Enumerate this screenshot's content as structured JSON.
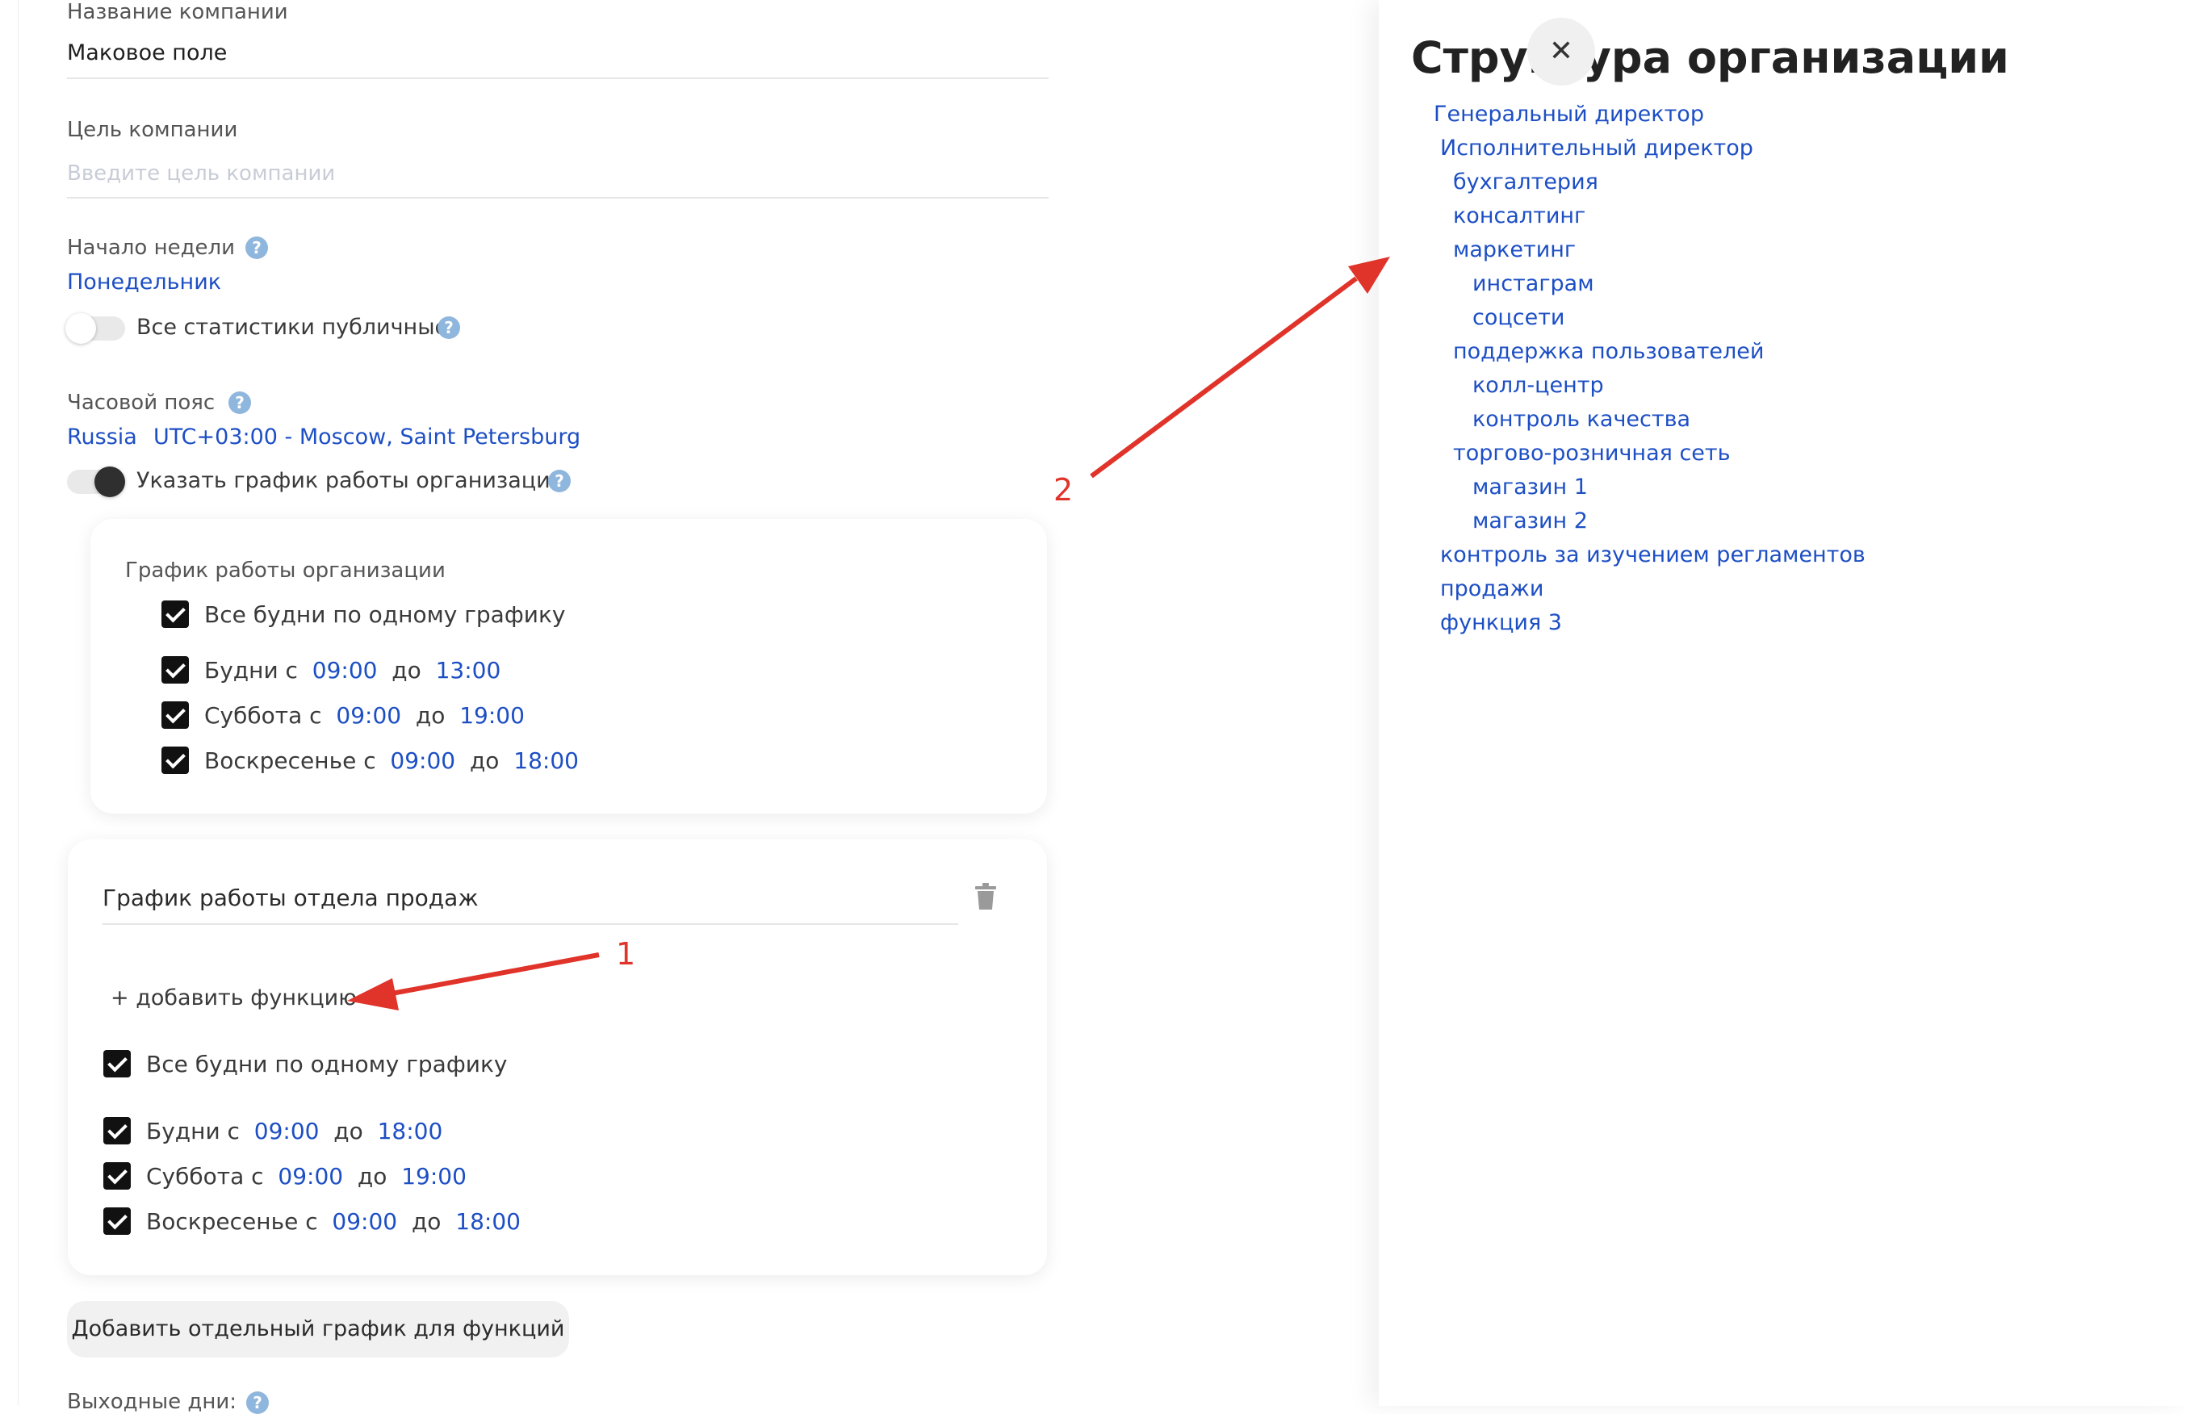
{
  "left": {
    "company_name": {
      "label": "Название компании",
      "value": "Маковое поле"
    },
    "company_goal": {
      "label": "Цель компании",
      "placeholder": "Введите цель компании"
    },
    "week_start": {
      "label": "Начало недели",
      "value": "Понедельник"
    },
    "public_stats": {
      "label": "Все статистики публичные",
      "on": false
    },
    "timezone": {
      "label": "Часовой пояс",
      "country": "Russia",
      "value": "UTC+03:00 - Moscow, Saint Petersburg"
    },
    "schedule_toggle": {
      "label": "Указать график работы организации",
      "on": true
    },
    "org_schedule": {
      "title": "График работы организации",
      "all_weekdays": "Все будни по одному графику",
      "rows": [
        {
          "prefix": "Будни с",
          "from": "09:00",
          "sep": "до",
          "to": "13:00"
        },
        {
          "prefix": "Суббота с",
          "from": "09:00",
          "sep": "до",
          "to": "19:00"
        },
        {
          "prefix": "Воскресенье с",
          "from": "09:00",
          "sep": "до",
          "to": "18:00"
        }
      ]
    },
    "sales_schedule": {
      "title": "График работы отдела продаж",
      "add_function": "+ добавить функцию",
      "all_weekdays": "Все будни по одному графику",
      "rows": [
        {
          "prefix": "Будни с",
          "from": "09:00",
          "sep": "до",
          "to": "18:00"
        },
        {
          "prefix": "Суббота с",
          "from": "09:00",
          "sep": "до",
          "to": "19:00"
        },
        {
          "prefix": "Воскресенье с",
          "from": "09:00",
          "sep": "до",
          "to": "18:00"
        }
      ]
    },
    "add_separate_button": "Добавить отдельный график для функций",
    "days_off_label": "Выходные дни:"
  },
  "right": {
    "title": "Структура организации",
    "close_icon": "close-icon",
    "tree": [
      {
        "label": "Генеральный директор",
        "level": 0
      },
      {
        "label": "Исполнительный директор",
        "level": 1
      },
      {
        "label": "бухгалтерия",
        "level": 2
      },
      {
        "label": "консалтинг",
        "level": 2
      },
      {
        "label": "маркетинг",
        "level": 2
      },
      {
        "label": "инстаграм",
        "level": 3
      },
      {
        "label": "соцсети",
        "level": 3
      },
      {
        "label": "поддержка пользователей",
        "level": 2
      },
      {
        "label": "колл-центр",
        "level": 3
      },
      {
        "label": "контроль качества",
        "level": 3
      },
      {
        "label": "торгово-розничная сеть",
        "level": 2
      },
      {
        "label": "магазин 1",
        "level": 3
      },
      {
        "label": "магазин 2",
        "level": 3
      },
      {
        "label": "контроль за изучением регламентов",
        "level": 1
      },
      {
        "label": "продажи",
        "level": 1
      },
      {
        "label": "функция 3",
        "level": 1
      }
    ]
  },
  "annotations": {
    "arrow1": "1",
    "arrow2": "2"
  },
  "colors": {
    "link": "#1d4fc4",
    "annotation": "#e0332a"
  }
}
